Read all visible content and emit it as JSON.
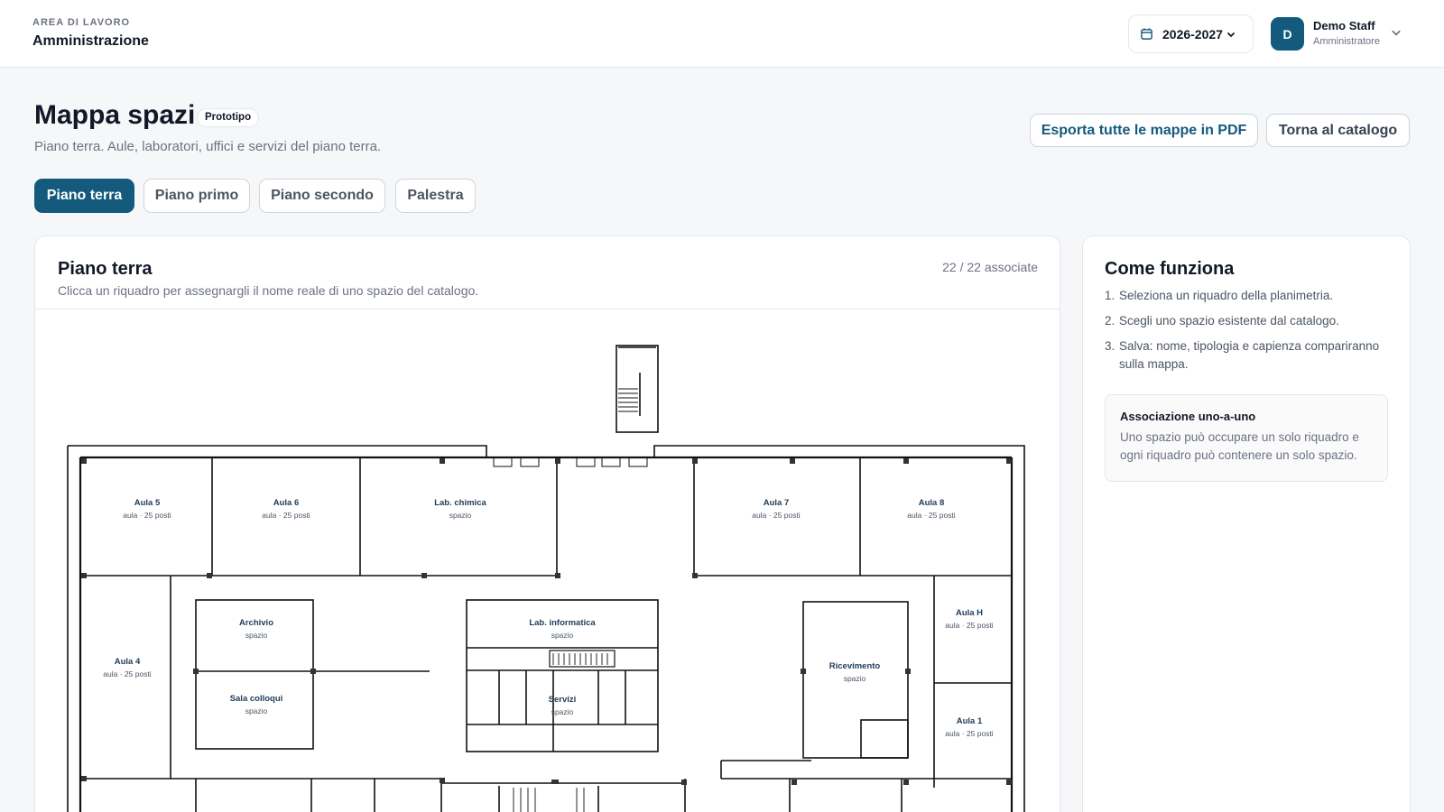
{
  "topbar": {
    "workspace_caption": "AREA DI LAVORO",
    "workspace_title": "Amministrazione",
    "year_selector": {
      "value": "2026-2027",
      "icon": "calendar-icon"
    },
    "user": {
      "initial": "D",
      "name": "Demo Staff",
      "role": "Amministratore"
    }
  },
  "page": {
    "title": "Mappa spazi",
    "badge": "Prototipo",
    "subtitle": "Piano terra. Aule, laboratori, uffici e servizi del piano terra.",
    "actions": {
      "export": "Esporta tutte le mappe in PDF",
      "back": "Torna al catalogo"
    }
  },
  "tabs": [
    {
      "label": "Piano terra",
      "active": true
    },
    {
      "label": "Piano primo",
      "active": false
    },
    {
      "label": "Piano secondo",
      "active": false
    },
    {
      "label": "Palestra",
      "active": false
    }
  ],
  "map": {
    "title": "Piano terra",
    "count": "22 / 22 associate",
    "hint": "Clicca un riquadro per assegnargli il nome reale di uno spazio del catalogo.",
    "rooms": [
      {
        "name": "Aula 5",
        "detail": "aula · 25 posti"
      },
      {
        "name": "Aula 6",
        "detail": "aula · 25 posti"
      },
      {
        "name": "Lab. chimica",
        "detail": "spazio"
      },
      {
        "name": "Aula 7",
        "detail": "aula · 25 posti"
      },
      {
        "name": "Aula 8",
        "detail": "aula · 25 posti"
      },
      {
        "name": "Archivio",
        "detail": "spazio"
      },
      {
        "name": "Lab. informatica",
        "detail": "spazio"
      },
      {
        "name": "Aula H",
        "detail": "aula · 25 posti"
      },
      {
        "name": "Aula 4",
        "detail": "aula · 25 posti"
      },
      {
        "name": "Ricevimento",
        "detail": "spazio"
      },
      {
        "name": "Sala colloqui",
        "detail": "spazio"
      },
      {
        "name": "Servizi",
        "detail": "spazio"
      },
      {
        "name": "Aula 1",
        "detail": "aula · 25 posti"
      }
    ]
  },
  "help": {
    "title": "Come funziona",
    "steps": [
      {
        "n": "1.",
        "text": "Seleziona un riquadro della planimetria."
      },
      {
        "n": "2.",
        "text": "Scegli uno spazio esistente dal catalogo."
      },
      {
        "n": "3.",
        "text": "Salva: nome, tipologia e capienza compariranno sulla mappa."
      }
    ],
    "note": {
      "title": "Associazione uno-a-uno",
      "body": "Uno spazio può occupare un solo riquadro e ogni riquadro può contenere un solo spazio."
    }
  },
  "colors": {
    "accent": "#145a7c",
    "border": "#e5e7eb",
    "muted": "#6b7280"
  }
}
